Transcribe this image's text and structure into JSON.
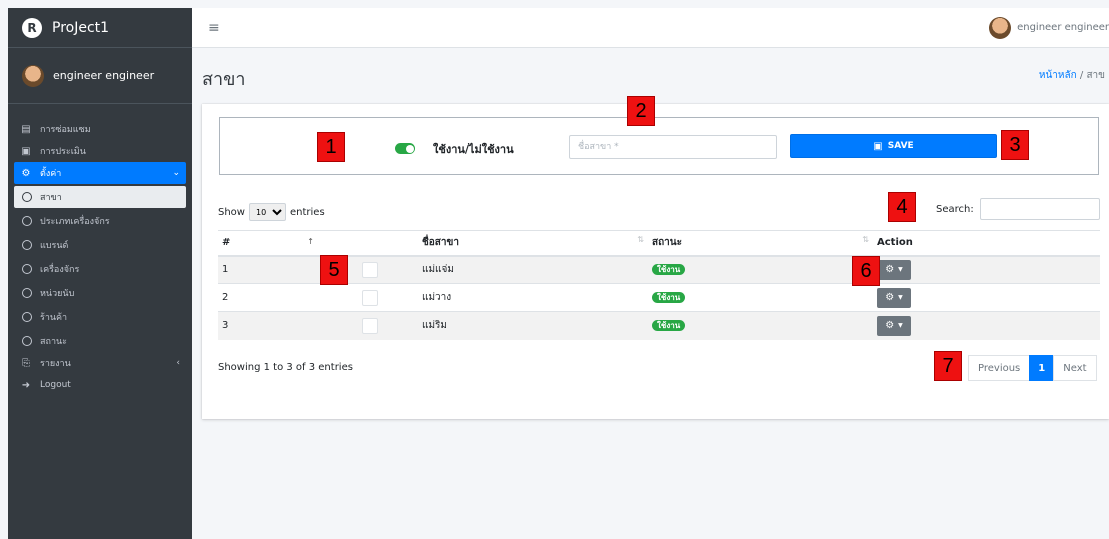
{
  "brand": {
    "name": "ProJect1",
    "logo_letter": "R"
  },
  "user": {
    "name": "engineer engineer"
  },
  "topbar": {
    "menu_icon": "≡",
    "user_name": "engineer engineer"
  },
  "sidebar": {
    "items": [
      {
        "label": "การซ่อมแซม",
        "icon": "clipboard-icon"
      },
      {
        "label": "การประเมิน",
        "icon": "clipboard-check-icon"
      },
      {
        "label": "ตั้งค่า",
        "icon": "gear-icon",
        "active": true
      }
    ],
    "subitems": [
      {
        "label": "สาขา",
        "active": true
      },
      {
        "label": "ประเภทเครื่องจักร"
      },
      {
        "label": "แบรนด์"
      },
      {
        "label": "เครื่องจักร"
      },
      {
        "label": "หน่วยนับ"
      },
      {
        "label": "ร้านค้า"
      },
      {
        "label": "สถานะ"
      }
    ],
    "report": {
      "label": "รายงาน",
      "icon": "file-pdf-icon"
    },
    "logout": {
      "label": "Logout",
      "icon": "sign-out-icon"
    }
  },
  "page": {
    "title": "สาขา",
    "breadcrumb_home": "หน้าหลัก",
    "breadcrumb_sep": "/",
    "breadcrumb_current": "สาข"
  },
  "form": {
    "toggle_label": "ใช้งาน/ไม่ใช้งาน",
    "toggle_on": true,
    "name_placeholder": "ชื่อสาขา *",
    "save_label": "SAVE"
  },
  "table": {
    "show_label": "Show",
    "entries_label": "entries",
    "page_length": "10",
    "search_label": "Search:",
    "columns": [
      "#",
      "ชื่อสาขา",
      "สถานะ",
      "Action"
    ],
    "rows": [
      {
        "no": "1",
        "name": "แม่แจ่ม",
        "status": "ใช้งาน"
      },
      {
        "no": "2",
        "name": "แม่วาง",
        "status": "ใช้งาน"
      },
      {
        "no": "3",
        "name": "แม่ริม",
        "status": "ใช้งาน"
      }
    ],
    "info": "Showing 1 to 3 of 3 entries",
    "pagination": {
      "previous": "Previous",
      "current": "1",
      "next": "Next"
    }
  },
  "annotations": [
    "1",
    "2",
    "3",
    "4",
    "5",
    "6",
    "7"
  ],
  "colors": {
    "primary": "#007bff",
    "success": "#28a745",
    "sidebar": "#343a40",
    "marker": "#ee1111"
  }
}
